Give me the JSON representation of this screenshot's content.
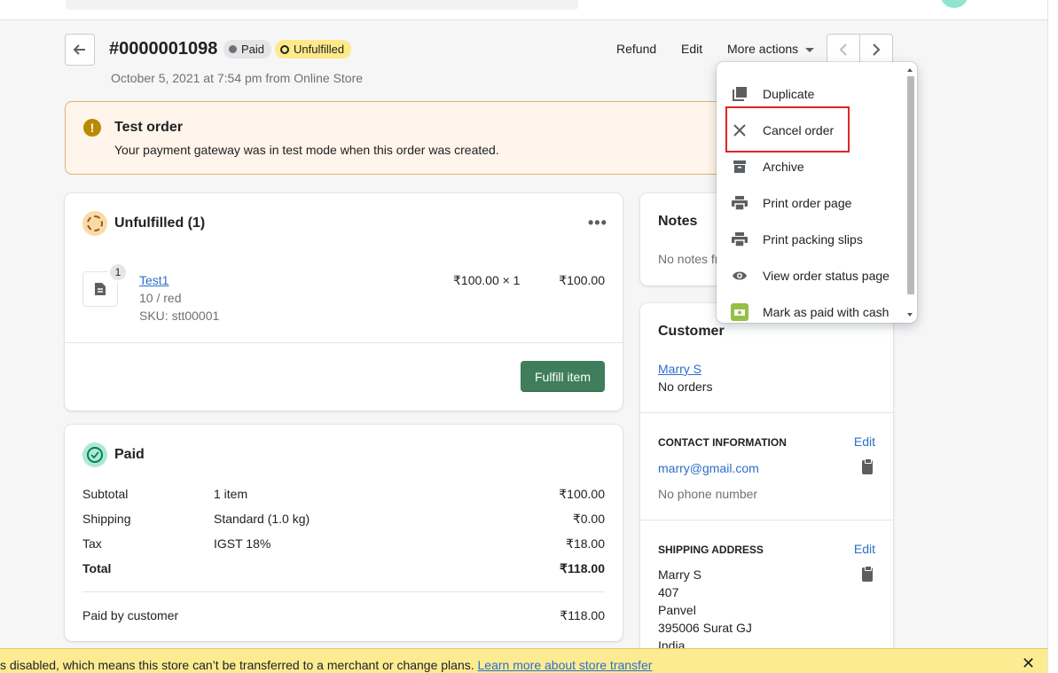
{
  "header": {
    "order_number": "#0000001098",
    "badge_paid": "Paid",
    "badge_unfulfilled": "Unfulfilled",
    "order_date": "October 5, 2021 at 7:54 pm from Online Store",
    "refund": "Refund",
    "edit": "Edit",
    "more_actions": "More actions"
  },
  "banner": {
    "title": "Test order",
    "description": "Your payment gateway was in test mode when this order was created."
  },
  "unfulfilled": {
    "title": "Unfulfilled (1)",
    "item": {
      "qty_badge": "1",
      "name": "Test1",
      "variant": "10 / red",
      "sku": "SKU: stt00001",
      "price_qty": "₹100.00 × 1",
      "total": "₹100.00"
    },
    "fulfill_button": "Fulfill item"
  },
  "paid": {
    "title": "Paid",
    "rows": [
      {
        "label": "Subtotal",
        "detail": "1 item",
        "amount": "₹100.00"
      },
      {
        "label": "Shipping",
        "detail": "Standard (1.0 kg)",
        "amount": "₹0.00"
      },
      {
        "label": "Tax",
        "detail": "IGST 18%",
        "amount": "₹18.00"
      },
      {
        "label": "Total",
        "detail": "",
        "amount": "₹118.00"
      }
    ],
    "paid_by_label": "Paid by customer",
    "paid_by_amount": "₹118.00"
  },
  "notes": {
    "title": "Notes",
    "text": "No notes fr"
  },
  "customer": {
    "title": "Customer",
    "name": "Marry S",
    "orders": "No orders",
    "contact_title": "CONTACT INFORMATION",
    "contact_edit": "Edit",
    "email": "marry@gmail.com",
    "phone": "No phone number",
    "shipping_title": "SHIPPING ADDRESS",
    "shipping_edit": "Edit",
    "address": [
      "Marry S",
      "407",
      "Panvel",
      "395006 Surat GJ",
      "India"
    ]
  },
  "menu": {
    "items": [
      {
        "label": "Duplicate",
        "icon": "duplicate-icon"
      },
      {
        "label": "Cancel order",
        "icon": "close-icon"
      },
      {
        "label": "Archive",
        "icon": "archive-icon"
      },
      {
        "label": "Print order page",
        "icon": "printer-icon"
      },
      {
        "label": "Print packing slips",
        "icon": "printer-icon"
      },
      {
        "label": "View order status page",
        "icon": "eye-icon"
      },
      {
        "label": "Mark as paid with cash",
        "icon": "cash-icon"
      }
    ]
  },
  "bottom_bar": {
    "message": "s disabled, which means this store can’t be transferred to a merchant or change plans.",
    "link": "Learn more about store transfer"
  },
  "colors": {
    "accent_link": "#2c6ecb",
    "fulfill_button": "#3f7d5b",
    "highlight": "#e02424",
    "warning_banner": "#fff5ea"
  }
}
